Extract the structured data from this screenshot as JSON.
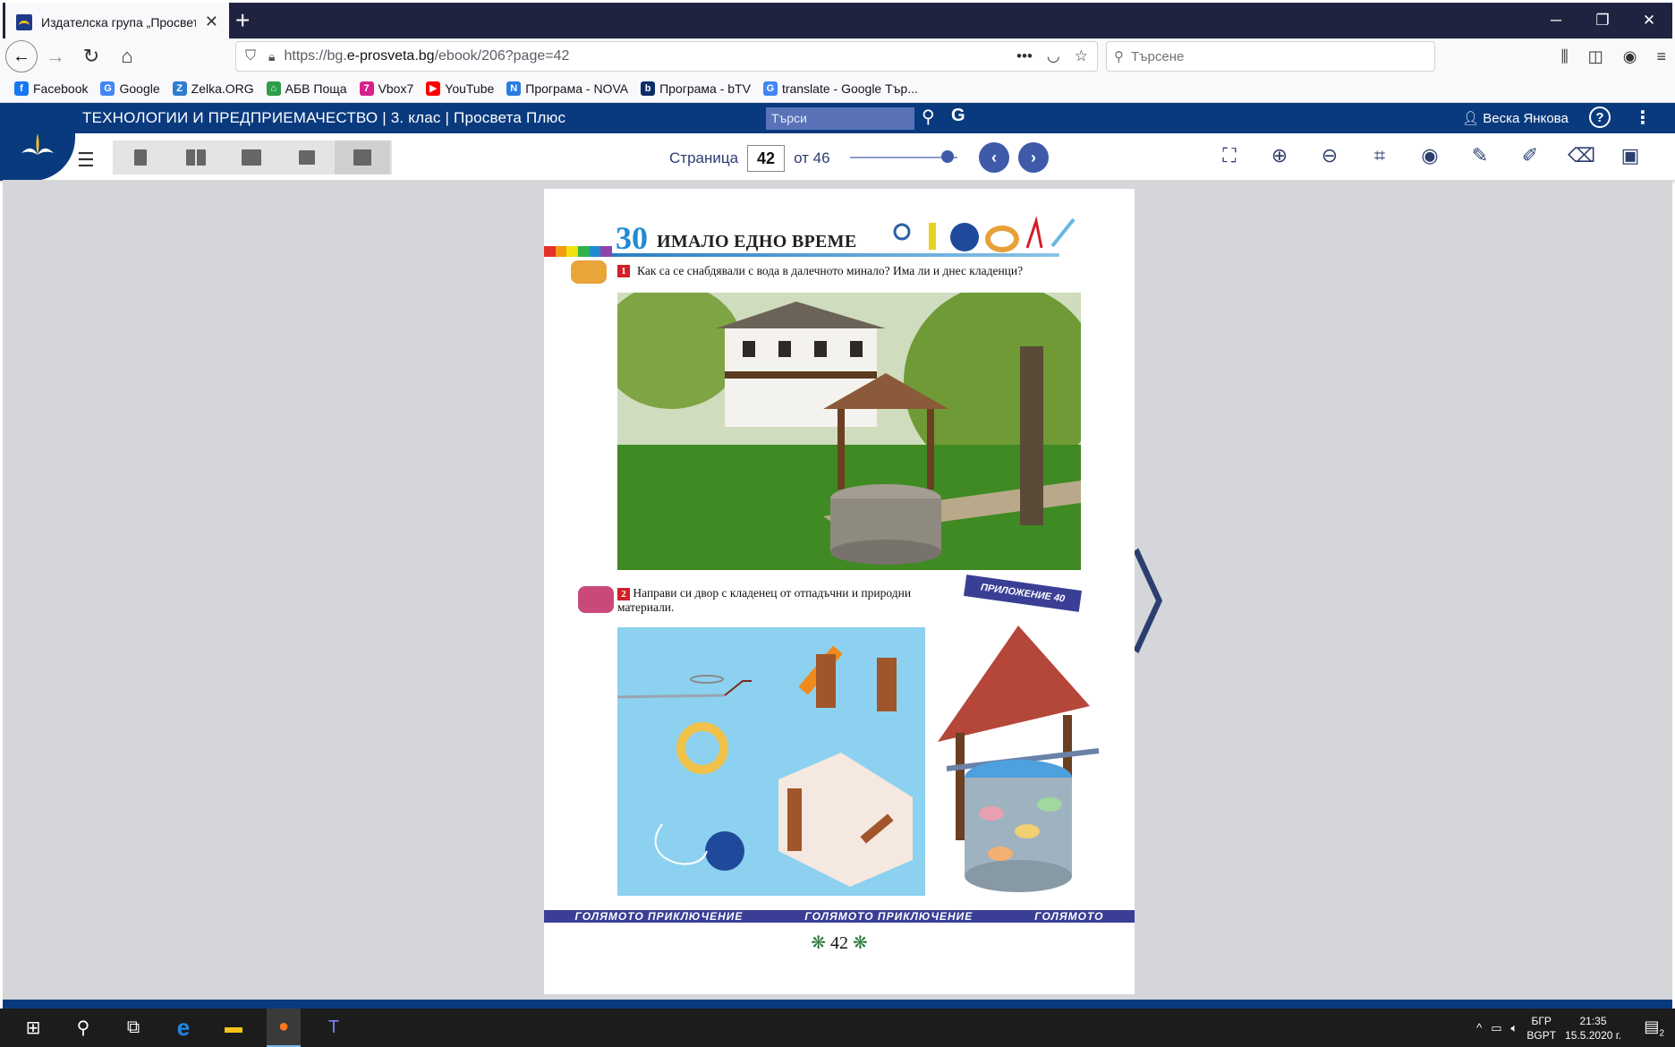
{
  "browser": {
    "tab_title": "Издателска група „Просвета“",
    "new_tab": "+",
    "url_prefix": "https://bg.",
    "url_host": "e-prosveta.bg",
    "url_path": "/ebook/206?page=42",
    "search_placeholder": "Търсене",
    "window_controls": [
      "─",
      "❐",
      "✕"
    ]
  },
  "bookmarks": [
    {
      "label": "Facebook",
      "icon": "facebook-icon",
      "color": "#1877f2",
      "glyph": "f"
    },
    {
      "label": "Google",
      "icon": "google-icon",
      "color": "#4285f4",
      "glyph": "G"
    },
    {
      "label": "Zelka.ORG",
      "icon": "zelka-icon",
      "color": "#2f7ccf",
      "glyph": "Z"
    },
    {
      "label": "АБВ Поща",
      "icon": "abv-icon",
      "color": "#2e9e4a",
      "glyph": "⌂"
    },
    {
      "label": "Vbox7",
      "icon": "vbox7-icon",
      "color": "#d6228a",
      "glyph": "7"
    },
    {
      "label": "YouTube",
      "icon": "youtube-icon",
      "color": "#ff0000",
      "glyph": "▶"
    },
    {
      "label": "Програма - NOVA",
      "icon": "nova-icon",
      "color": "#2a7de1",
      "glyph": "N"
    },
    {
      "label": "Програма - bTV",
      "icon": "btv-icon",
      "color": "#0b2d6b",
      "glyph": "b"
    },
    {
      "label": "translate - Google Тър...",
      "icon": "google-translate-icon",
      "color": "#4285f4",
      "glyph": "G"
    }
  ],
  "app": {
    "title": "ТЕХНОЛОГИИ И ПРЕДПРИЕМАЧЕСТВО | 3. клас | Просвета Плюс",
    "search_placeholder": "Търси",
    "user_name": "Веска Янкова",
    "help": "?"
  },
  "pager": {
    "label": "Страница",
    "current": "42",
    "of_label": "от 46",
    "slider_fraction": 0.91
  },
  "page": {
    "lesson_number": "30",
    "lesson_title": "ИМАЛО ЕДНО ВРЕМЕ",
    "task1_number": "1",
    "task1_text": "Как са се снабдявали с вода в далечното минало? Има ли и днес кладенци?",
    "task2_number": "2",
    "task2_text": "Направи си двор с кладенец от отпадъчни и природни материали.",
    "appendix_label": "ПРИЛОЖЕНИЕ 40",
    "footer_band": [
      "ГОЛЯМОТО ПРИКЛЮЧЕНИЕ",
      "ГОЛЯМОТО ПРИКЛЮЧЕНИЕ",
      "ГОЛЯМОТО"
    ],
    "page_number": "42",
    "stripe_colors": [
      "#e4322b",
      "#f39c12",
      "#f1e10f",
      "#2db34a",
      "#1f8bd0",
      "#8e44ad"
    ]
  },
  "taskbar": {
    "lang_top": "БГР",
    "lang_bottom": "BGPT",
    "time": "21:35",
    "date": "15.5.2020 г.",
    "notifications": "2"
  }
}
